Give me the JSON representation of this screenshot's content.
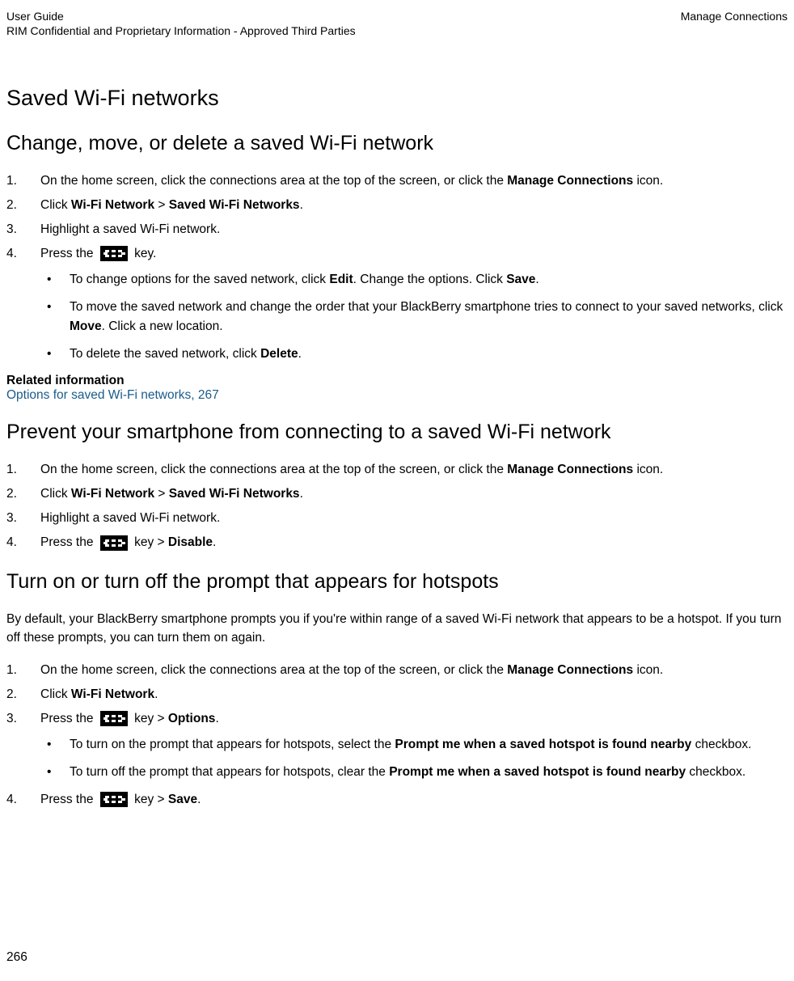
{
  "header": {
    "left1": "User Guide",
    "right": "Manage Connections",
    "left2": "RIM Confidential and Proprietary Information - Approved Third Parties"
  },
  "h1": "Saved Wi-Fi networks",
  "section1": {
    "title": "Change, move, or delete a saved Wi-Fi network",
    "step1a": "On the home screen, click the connections area at the top of the screen, or click the ",
    "step1b": "Manage Connections",
    "step1c": " icon.",
    "step2a": "Click ",
    "step2b": "Wi-Fi Network",
    "step2c": " > ",
    "step2d": "Saved Wi-Fi Networks",
    "step2e": ".",
    "step3": "Highlight a saved Wi-Fi network.",
    "step4a": "Press the ",
    "step4b": " key.",
    "b1a": "To change options for the saved network, click ",
    "b1b": "Edit",
    "b1c": ". Change the options. Click ",
    "b1d": "Save",
    "b1e": ".",
    "b2a": "To move the saved network and change the order that your BlackBerry smartphone tries to connect to your saved networks, click ",
    "b2b": "Move",
    "b2c": ". Click a new location.",
    "b3a": "To delete the saved network, click ",
    "b3b": "Delete",
    "b3c": ".",
    "relatedHeading": "Related information",
    "relatedLink": "Options for saved Wi-Fi networks, ",
    "relatedPage": "267"
  },
  "section2": {
    "title": "Prevent your smartphone from connecting to a saved Wi-Fi network",
    "step1a": "On the home screen, click the connections area at the top of the screen, or click the ",
    "step1b": "Manage Connections",
    "step1c": " icon.",
    "step2a": "Click ",
    "step2b": "Wi-Fi Network",
    "step2c": " > ",
    "step2d": "Saved Wi-Fi Networks",
    "step2e": ".",
    "step3": "Highlight a saved Wi-Fi network.",
    "step4a": " Press the ",
    "step4b": " key > ",
    "step4c": "Disable",
    "step4d": "."
  },
  "section3": {
    "title": "Turn on or turn off the prompt that appears for hotspots",
    "intro": "By default, your BlackBerry smartphone prompts you if you're within range of a saved Wi-Fi network that appears to be a hotspot. If you turn off these prompts, you can turn them on again.",
    "step1a": "On the home screen, click the connections area at the top of the screen, or click the ",
    "step1b": "Manage Connections",
    "step1c": " icon.",
    "step2a": "Click ",
    "step2b": "Wi-Fi Network",
    "step2c": ".",
    "step3a": "Press the ",
    "step3b": " key > ",
    "step3c": "Options",
    "step3d": ".",
    "b1a": "To turn on the prompt that appears for hotspots, select the ",
    "b1b": "Prompt me when a saved hotspot is found nearby",
    "b1c": " checkbox.",
    "b2a": "To turn off the prompt that appears for hotspots, clear the ",
    "b2b": "Prompt me when a saved hotspot is found nearby",
    "b2c": " checkbox.",
    "step4a": " Press the ",
    "step4b": " key > ",
    "step4c": "Save",
    "step4d": "."
  },
  "pageNumber": "266"
}
